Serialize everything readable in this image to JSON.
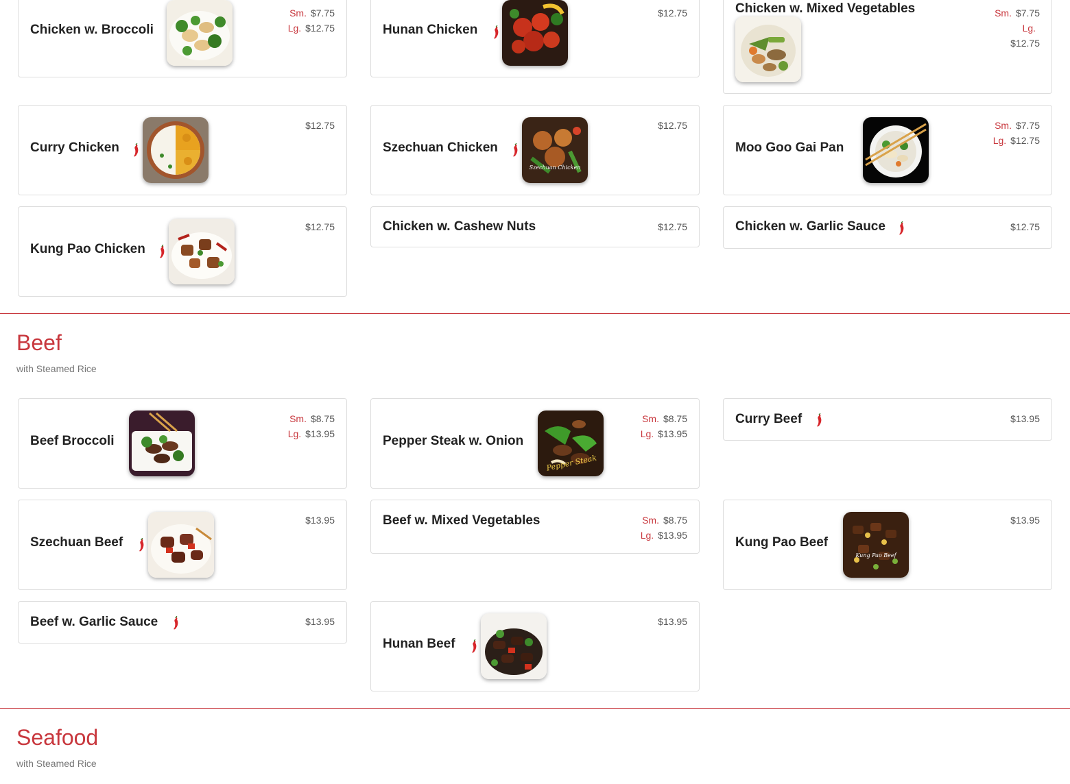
{
  "colors": {
    "accent": "#c8373d",
    "border": "#dddddd",
    "text": "#222222",
    "muted": "#777777"
  },
  "chicken": {
    "items": [
      {
        "name": "Chicken w. Broccoli",
        "sm_label": "Sm.",
        "sm_price": "$7.75",
        "lg_label": "Lg.",
        "lg_price": "$12.75"
      },
      {
        "name": "Hunan Chicken",
        "price": "$12.75"
      },
      {
        "name": "Chicken w. Mixed Vegetables",
        "sm_label": "Sm.",
        "sm_price": "$7.75",
        "lg_label": "Lg.",
        "lg_price": "$12.75"
      },
      {
        "name": "Curry Chicken",
        "price": "$12.75"
      },
      {
        "name": "Szechuan Chicken",
        "price": "$12.75",
        "image_caption": "Szechuan Chicken"
      },
      {
        "name": "Moo Goo Gai Pan",
        "sm_label": "Sm.",
        "sm_price": "$7.75",
        "lg_label": "Lg.",
        "lg_price": "$12.75"
      },
      {
        "name": "Kung Pao Chicken",
        "price": "$12.75"
      },
      {
        "name": "Chicken w. Cashew Nuts",
        "price": "$12.75"
      },
      {
        "name": "Chicken w. Garlic Sauce",
        "price": "$12.75"
      }
    ]
  },
  "beef": {
    "title": "Beef",
    "subtitle": "with Steamed Rice",
    "items": [
      {
        "name": "Beef Broccoli",
        "sm_label": "Sm.",
        "sm_price": "$8.75",
        "lg_label": "Lg.",
        "lg_price": "$13.95"
      },
      {
        "name": "Pepper Steak w. Onion",
        "sm_label": "Sm.",
        "sm_price": "$8.75",
        "lg_label": "Lg.",
        "lg_price": "$13.95",
        "image_caption": "Pepper Steak"
      },
      {
        "name": "Curry Beef",
        "price": "$13.95"
      },
      {
        "name": "Szechuan Beef",
        "price": "$13.95"
      },
      {
        "name": "Beef w. Mixed Vegetables",
        "sm_label": "Sm.",
        "sm_price": "$8.75",
        "lg_label": "Lg.",
        "lg_price": "$13.95"
      },
      {
        "name": "Kung Pao Beef",
        "price": "$13.95",
        "image_caption": "Kung Pao Beef"
      },
      {
        "name": "Beef w. Garlic Sauce",
        "price": "$13.95"
      },
      {
        "name": "Hunan Beef",
        "price": "$13.95"
      }
    ]
  },
  "seafood": {
    "title": "Seafood",
    "subtitle": "with Steamed Rice"
  }
}
